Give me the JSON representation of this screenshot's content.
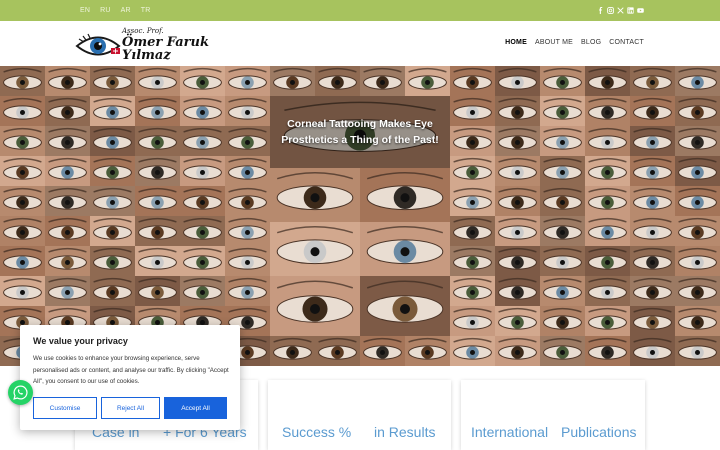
{
  "topbar": {
    "languages": [
      "EN",
      "RU",
      "AR",
      "TR"
    ],
    "socials": [
      "facebook-icon",
      "instagram-icon",
      "x-icon",
      "linkedin-icon",
      "youtube-icon"
    ]
  },
  "logo": {
    "small": "Assoc. Prof.",
    "line1": "Ömer Faruk",
    "line2": "Yılmaz"
  },
  "nav": {
    "items": [
      "HOME",
      "ABOUT ME",
      "BLOG",
      "CONTACT"
    ],
    "active": "HOME"
  },
  "hero": {
    "title_line1": "Corneal Tattooing Makes Eye",
    "title_line2": "Prosthetics a Thing of the Past!"
  },
  "stats": [
    {
      "left": "Case in",
      "right": "+ For 6 Years"
    },
    {
      "left": "Success %",
      "right": "in Results"
    },
    {
      "left": "International",
      "right": "Publications"
    }
  ],
  "cookie": {
    "title": "We value your privacy",
    "text": "We use cookies to enhance your browsing experience, serve personalised ads or content, and analyse our traffic. By clicking \"Accept All\", you consent to our use of cookies.",
    "customise": "Customise",
    "reject": "Reject All",
    "accept": "Accept All"
  },
  "colors": {
    "topbar": "#a7c35e",
    "accent": "#1863dc",
    "stat_text": "#5b9bd0",
    "whatsapp": "#25d366"
  }
}
